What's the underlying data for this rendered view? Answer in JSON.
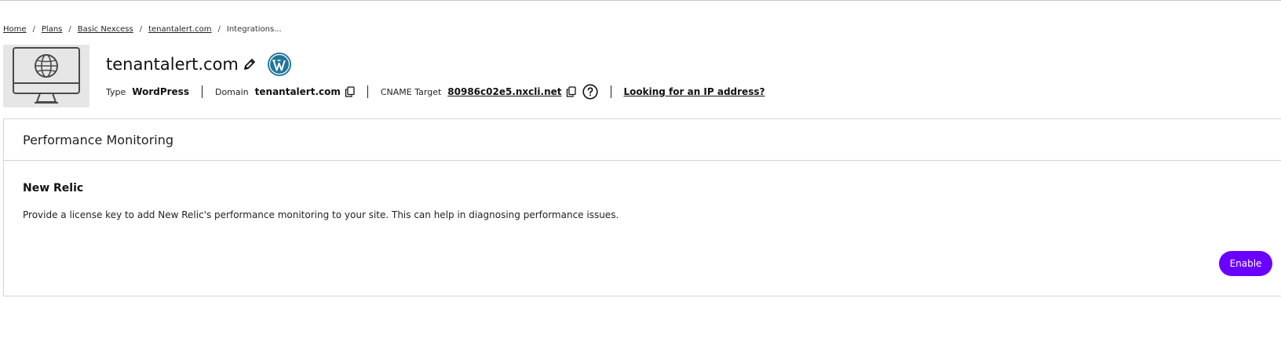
{
  "breadcrumb": {
    "items": [
      "Home",
      "Plans",
      "Basic Nexcess",
      "tenantalert.com"
    ],
    "current": "Integrations...",
    "separator": "/"
  },
  "site": {
    "title": "tenantalert.com",
    "type_label": "Type",
    "type_value": "WordPress",
    "domain_label": "Domain",
    "domain_value": "tenantalert.com",
    "cname_label": "CNAME Target",
    "cname_value": "80986c02e5.nxcli.net",
    "ip_link": "Looking for an IP address?"
  },
  "card": {
    "title": "Performance Monitoring",
    "section_title": "New Relic",
    "section_desc": "Provide a license key to add New Relic's performance monitoring to your site. This can help in diagnosing performance issues.",
    "enable_label": "Enable"
  },
  "icons": {
    "thumbnail": "monitor-globe-icon",
    "edit": "pencil-icon",
    "platform": "wordpress-icon",
    "copy": "copy-icon",
    "help": "question-circle-icon"
  },
  "colors": {
    "accent": "#6a00ff",
    "wordpress": "#21759b",
    "thumb_bg": "#e6e6e6"
  }
}
